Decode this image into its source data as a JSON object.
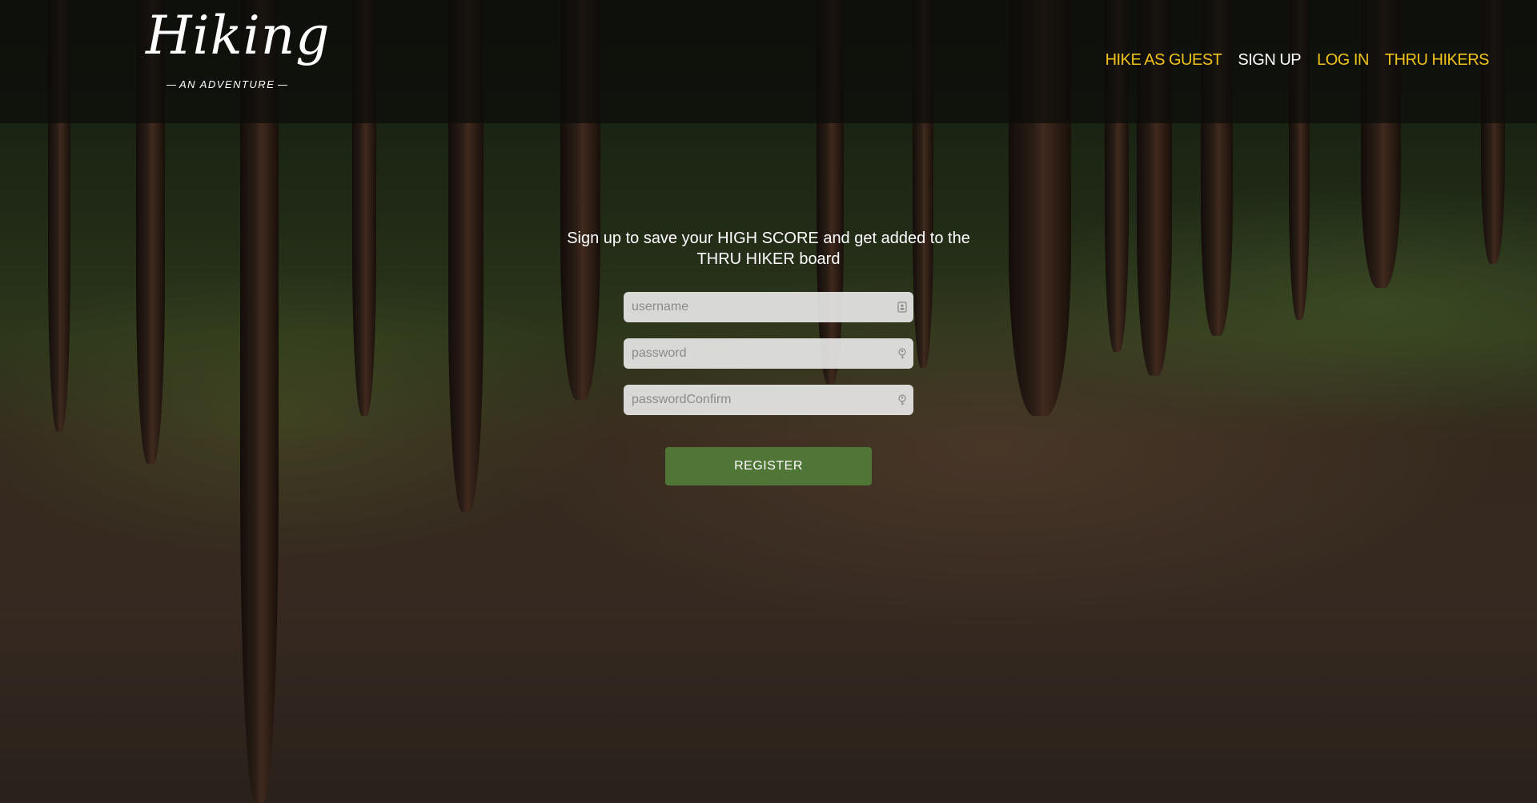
{
  "header": {
    "logo": {
      "title": "Hiking",
      "tagline": "AN ADVENTURE"
    },
    "nav": [
      {
        "label": "HIKE AS GUEST"
      },
      {
        "label": "SIGN UP"
      },
      {
        "label": "LOG IN"
      },
      {
        "label": "THRU HIKERS"
      }
    ],
    "active_nav": "SIGN UP"
  },
  "signup": {
    "headline": "Sign up to save your HIGH SCORE and get added to the THRU HIKER board",
    "fields": [
      {
        "placeholder": "username",
        "value": "",
        "icon": "contact-card-icon"
      },
      {
        "placeholder": "password",
        "value": "",
        "icon": "key-icon"
      },
      {
        "placeholder": "passwordConfirm",
        "value": "",
        "icon": "key-icon"
      }
    ],
    "submit_label": "REGISTER"
  },
  "colors": {
    "nav_gold": "#f0c21c",
    "nav_active": "#ffffff",
    "button_green": "#4f7537",
    "header_overlay": "rgba(12,12,10,0.72)"
  }
}
